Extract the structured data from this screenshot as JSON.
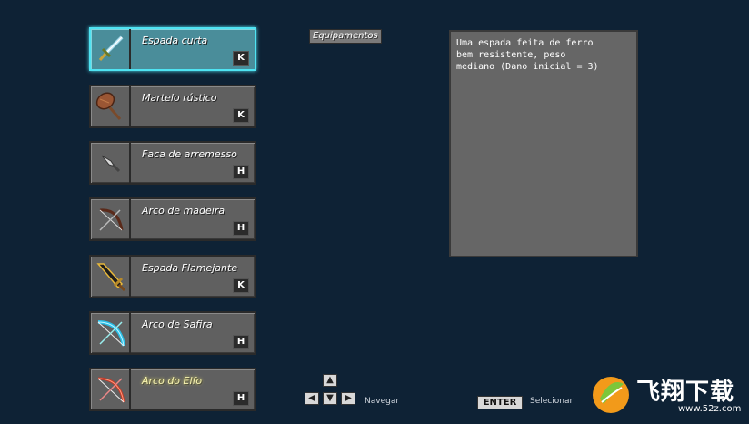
{
  "section_title": "Equipamentos",
  "description": "Uma espada feita de ferro\nbem resistente, peso\nmediano (Dano inicial = 3)",
  "items": [
    {
      "label": "Espada curta",
      "key": "K",
      "icon": "short-sword-icon"
    },
    {
      "label": "Martelo rústico",
      "key": "K",
      "icon": "hammer-icon"
    },
    {
      "label": "Faca de arremesso",
      "key": "H",
      "icon": "throwing-knife-icon"
    },
    {
      "label": "Arco de madeira",
      "key": "H",
      "icon": "wooden-bow-icon"
    },
    {
      "label": "Espada Flamejante",
      "key": "K",
      "icon": "flaming-sword-icon"
    },
    {
      "label": "Arco de Safira",
      "key": "H",
      "icon": "sapphire-bow-icon"
    },
    {
      "label": "Arco do Elfo",
      "key": "H",
      "icon": "elf-bow-icon"
    }
  ],
  "controls": {
    "navigate_label": "Navegar",
    "enter_key": "ENTER",
    "select_label": "Selecionar",
    "arrow_up": "▲",
    "arrow_left": "◀",
    "arrow_down": "▼",
    "arrow_right": "▶"
  },
  "watermark": {
    "text_cn": "飞翔下载",
    "url": "www.52z.com"
  },
  "colors": {
    "background": "#0e2235",
    "selected_border": "#4fe3f2",
    "selected_fill": "#4a8d9a",
    "slot_fill": "#606060"
  }
}
